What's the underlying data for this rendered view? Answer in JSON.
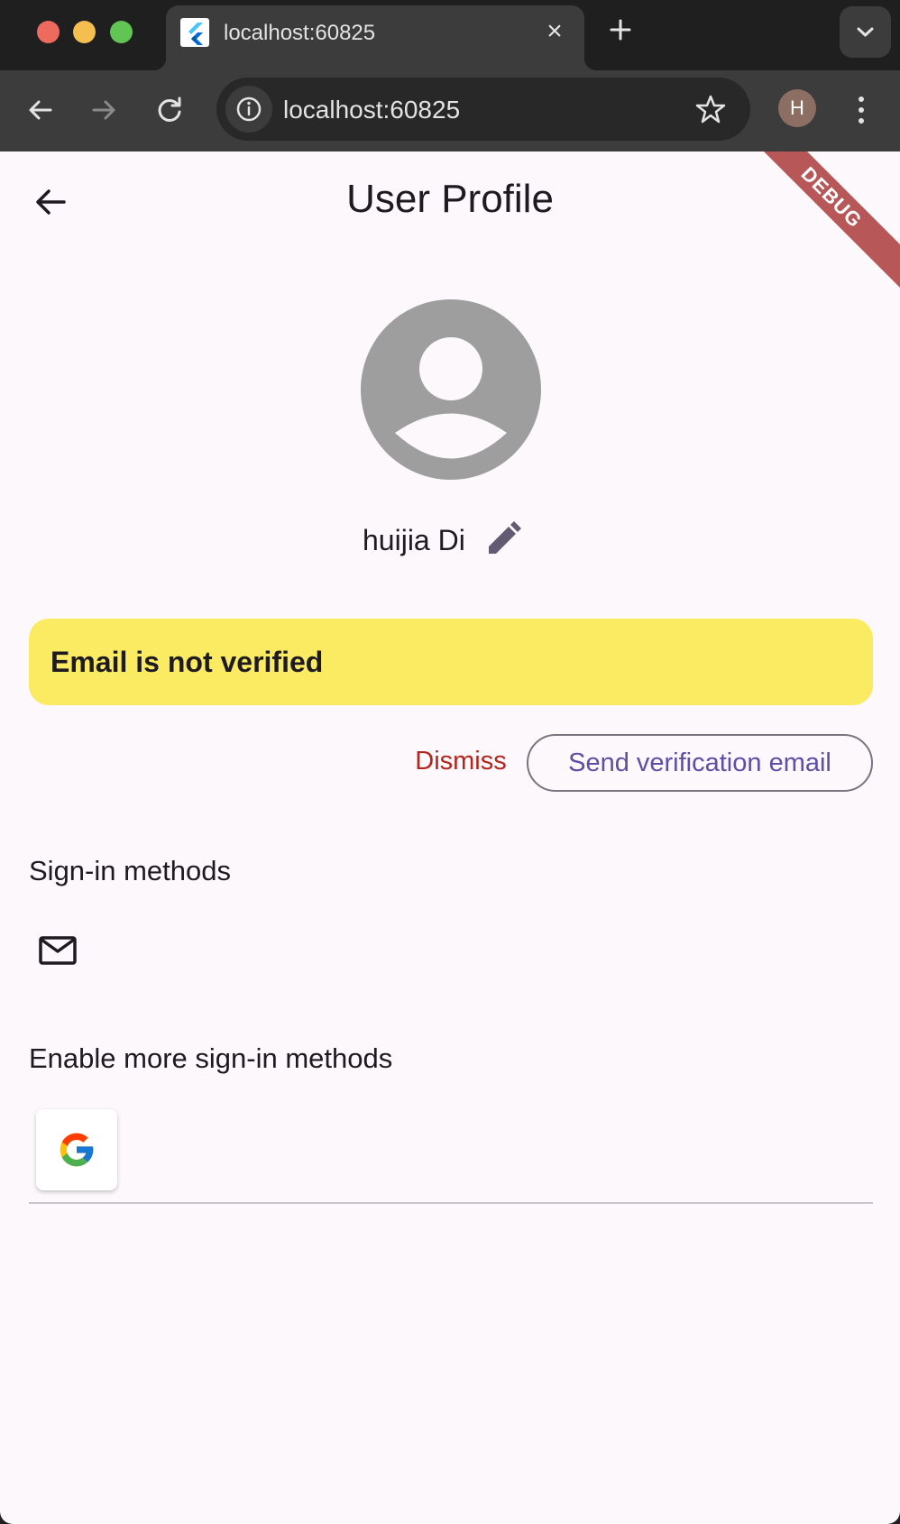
{
  "browser": {
    "tab_title": "localhost:60825",
    "url": "localhost:60825",
    "profile_initial": "H"
  },
  "app": {
    "title": "User Profile",
    "debug_banner": "DEBUG",
    "display_name": "huijia Di",
    "verification_banner": "Email is not verified",
    "dismiss_label": "Dismiss",
    "send_verification_label": "Send verification email",
    "signin_methods_heading": "Sign-in methods",
    "enable_more_heading": "Enable more sign-in methods",
    "signin_methods": [
      "mail-icon"
    ],
    "available_providers": [
      "google-icon"
    ]
  },
  "colors": {
    "banner_bg": "#fbeb63",
    "dismiss_text": "#b3261e",
    "primary_text": "#5d4fa6",
    "page_bg": "#fcf8fc"
  }
}
